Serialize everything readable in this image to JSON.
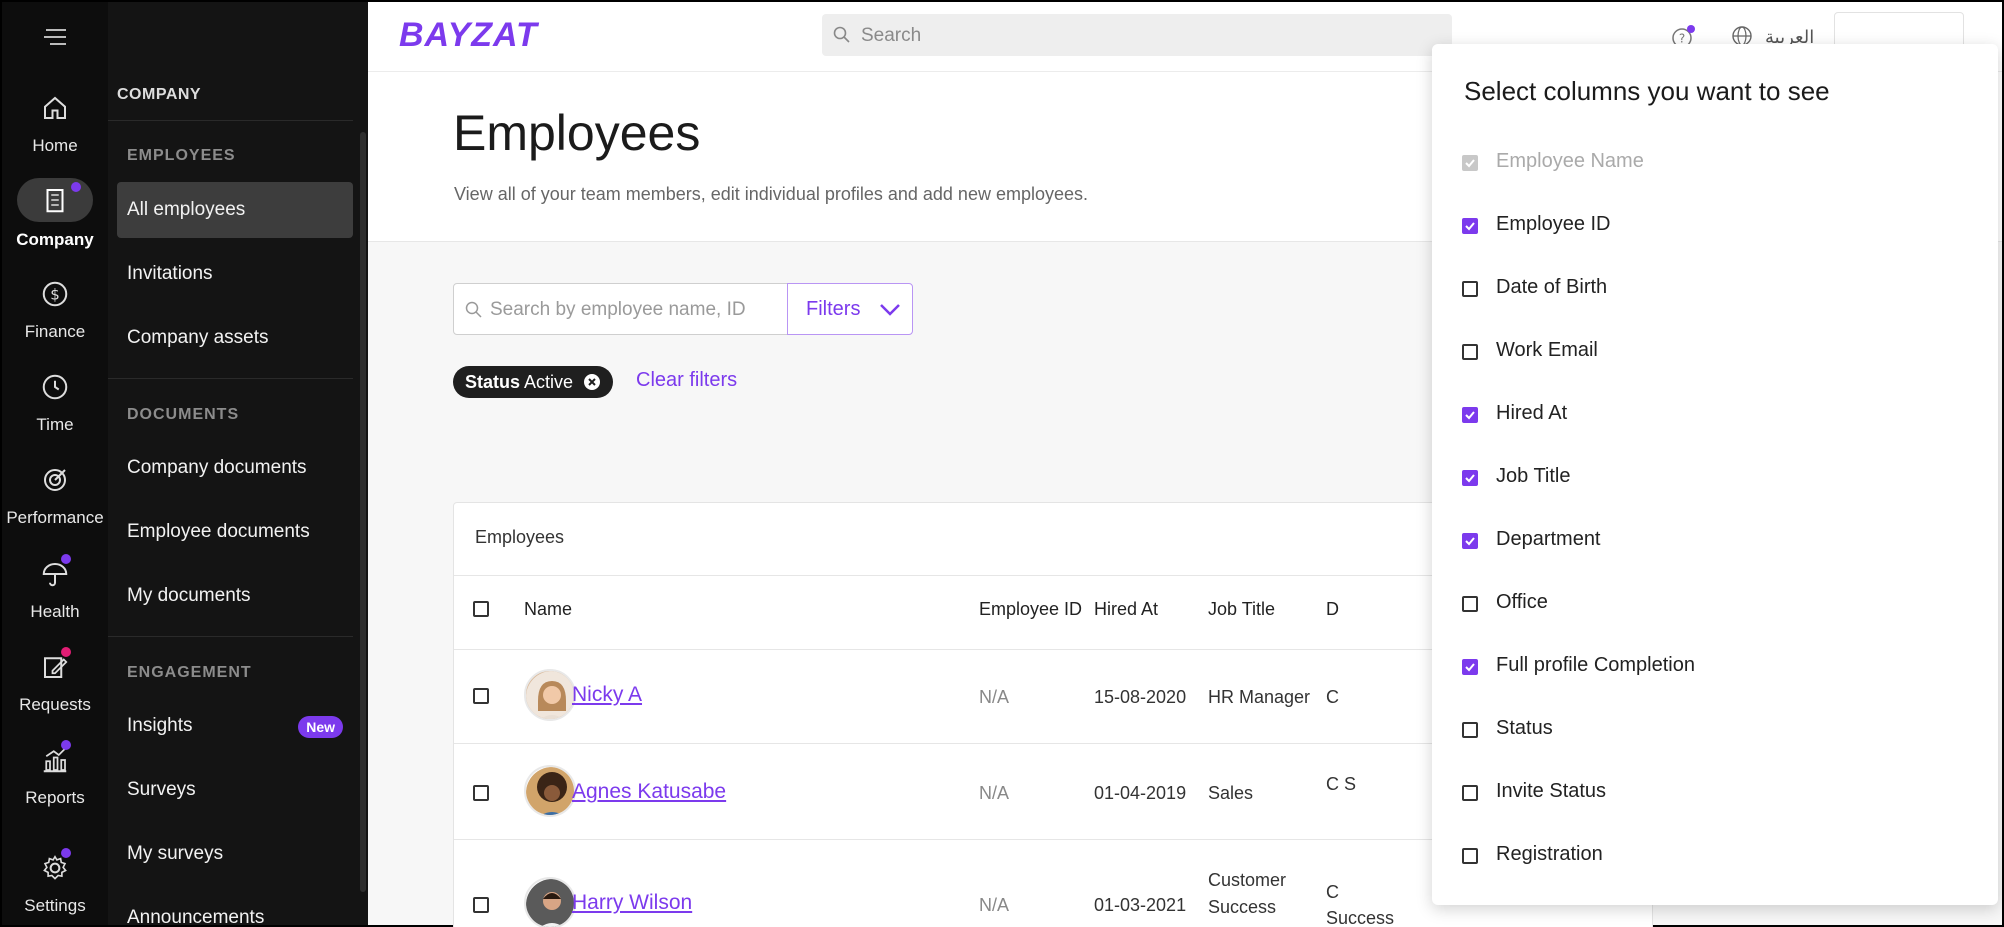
{
  "rail": {
    "items": [
      {
        "label": "Home",
        "icon": "home-icon"
      },
      {
        "label": "Company",
        "icon": "building-icon",
        "active": true,
        "dot": true
      },
      {
        "label": "Finance",
        "icon": "dollar-icon"
      },
      {
        "label": "Time",
        "icon": "clock-icon"
      },
      {
        "label": "Performance",
        "icon": "target-icon"
      },
      {
        "label": "Health",
        "icon": "umbrella-icon",
        "dot": true
      },
      {
        "label": "Requests",
        "icon": "edit-icon",
        "dot": true
      },
      {
        "label": "Reports",
        "icon": "chart-icon",
        "dot": true
      },
      {
        "label": "Settings",
        "icon": "gear-icon",
        "dot": true
      }
    ]
  },
  "subnav": {
    "title": "COMPANY",
    "sections": [
      {
        "label": "EMPLOYEES",
        "items": [
          "All employees",
          "Invitations",
          "Company assets"
        ]
      },
      {
        "label": "DOCUMENTS",
        "items": [
          "Company documents",
          "Employee documents",
          "My documents"
        ]
      },
      {
        "label": "ENGAGEMENT",
        "items": [
          "Insights",
          "Surveys",
          "My surveys",
          "Announcements"
        ]
      }
    ],
    "new_badge": "New"
  },
  "topbar": {
    "logo": "BAYZAT",
    "search_placeholder": "Search",
    "language": "العربية"
  },
  "page": {
    "title": "Employees",
    "subtitle": "View all of your team members, edit individual profiles and add new employees.",
    "search_placeholder": "Search by employee name, ID",
    "filters_label": "Filters",
    "chip_key": "Status",
    "chip_value": "Active",
    "clear_filters": "Clear filters"
  },
  "table": {
    "title": "Employees",
    "columns": [
      "Name",
      "Employee ID",
      "Hired At",
      "Job Title",
      "D"
    ],
    "rows": [
      {
        "name": "Nicky A",
        "id": "N/A",
        "hired": "15-08-2020",
        "job": "HR Manager",
        "dept": "C"
      },
      {
        "name": "Agnes Katusabe",
        "id": "N/A",
        "hired": "01-04-2019",
        "job": "Sales",
        "dept": "C S"
      },
      {
        "name": "Harry Wilson",
        "id": "N/A",
        "hired": "01-03-2021",
        "job": "Customer Success",
        "dept": "C Success"
      }
    ]
  },
  "column_chooser": {
    "title": "Select columns you want to see",
    "options": [
      {
        "label": "Employee Name",
        "checked": true,
        "disabled": true
      },
      {
        "label": "Employee ID",
        "checked": true
      },
      {
        "label": "Date of Birth",
        "checked": false
      },
      {
        "label": "Work Email",
        "checked": false
      },
      {
        "label": "Hired At",
        "checked": true
      },
      {
        "label": "Job Title",
        "checked": true
      },
      {
        "label": "Department",
        "checked": true
      },
      {
        "label": "Office",
        "checked": false
      },
      {
        "label": "Full profile Completion",
        "checked": true
      },
      {
        "label": "Status",
        "checked": false
      },
      {
        "label": "Invite Status",
        "checked": false
      },
      {
        "label": "Registration",
        "checked": false
      }
    ]
  },
  "colors": {
    "accent": "#7c3aed",
    "rail_bg": "#0d0d0d",
    "subnav_bg": "#141414"
  }
}
